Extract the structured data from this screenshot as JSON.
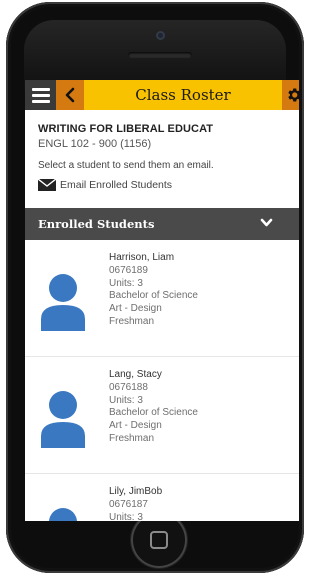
{
  "header": {
    "title": "Class Roster",
    "menu_icon": "hamburger-menu-icon",
    "back_icon": "chevron-left-icon",
    "settings_icon": "gear-icon"
  },
  "course": {
    "title": "WRITING FOR LIBERAL EDUCAT",
    "code": "ENGL 102 - 900 (1156)"
  },
  "instruction": "Select a student to send them an email.",
  "email_all": {
    "label": "Email Enrolled Students",
    "icon": "envelope-icon"
  },
  "section": {
    "label": "Enrolled Students",
    "icon": "chevron-down-icon"
  },
  "students": [
    {
      "name": "Harrison, Liam",
      "id": "0676189",
      "units": "Units: 3",
      "degree": "Bachelor of Science",
      "major": "Art - Design",
      "level": "Freshman"
    },
    {
      "name": "Lang, Stacy",
      "id": "0676188",
      "units": "Units: 3",
      "degree": "Bachelor of Science",
      "major": "Art - Design",
      "level": "Freshman"
    },
    {
      "name": "Lily, JimBob",
      "id": "0676187",
      "units": "Units: 3",
      "degree": "",
      "major": "",
      "level": ""
    }
  ],
  "colors": {
    "header_bg": "#f8c200",
    "header_button_bg": "#d47a10",
    "menu_button_bg": "#3a3a3a",
    "section_bar_bg": "#4a4a4a",
    "avatar": "#3a78c2"
  }
}
